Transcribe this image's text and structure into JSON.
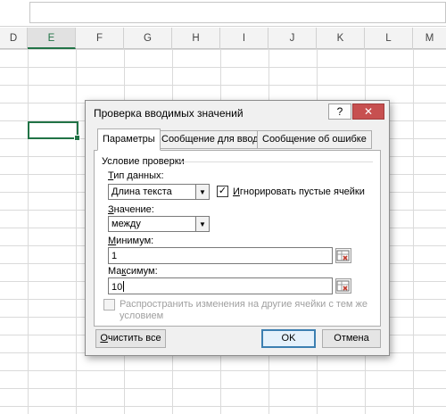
{
  "spreadsheet": {
    "columns": [
      "D",
      "E",
      "F",
      "G",
      "H",
      "I",
      "J",
      "K",
      "L",
      "M"
    ],
    "active_column": "E"
  },
  "dialog": {
    "title": "Проверка вводимых значений",
    "help_label": "?",
    "close_label": "✕",
    "tabs": [
      {
        "label": "Параметры",
        "active": true
      },
      {
        "label": "Сообщение для ввода",
        "active": false
      },
      {
        "label": "Сообщение об ошибке",
        "active": false
      }
    ],
    "group_label": "Условие проверки",
    "data_type": {
      "label_first": "Т",
      "label_rest": "ип данных:",
      "value": "Длина текста"
    },
    "ignore_blank": {
      "label_first": "И",
      "label_rest": "гнорировать пустые ячейки",
      "checked": true
    },
    "operator": {
      "label_first": "З",
      "label_rest": "начение:",
      "value": "между"
    },
    "minimum": {
      "label_first": "М",
      "label_rest": "инимум:",
      "value": "1"
    },
    "maximum": {
      "label_first": "Ма",
      "label_u": "к",
      "label_rest": "симум:",
      "value": "10"
    },
    "apply_all": {
      "label_line1": "Распространить изменения на другие ячейки с тем же",
      "label_line2": "условием",
      "checked": false
    },
    "buttons": {
      "clear_all_first": "О",
      "clear_all_rest": "чистить все",
      "ok": "OK",
      "cancel": "Отмена"
    }
  }
}
